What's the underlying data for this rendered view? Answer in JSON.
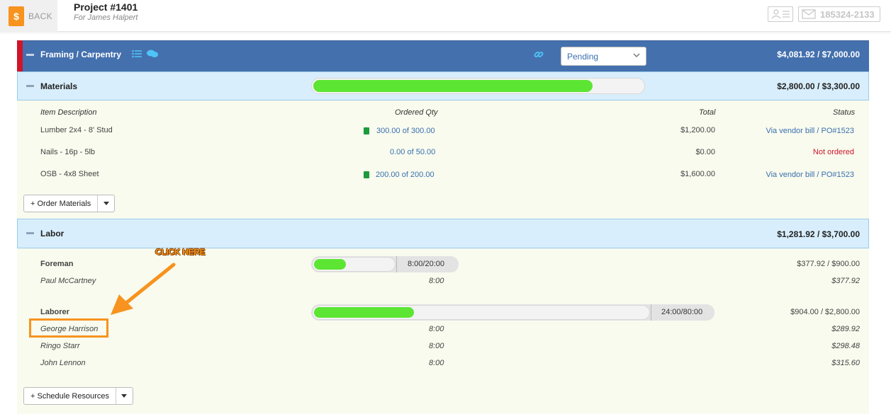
{
  "topbar": {
    "back_label": "BACK",
    "back_glyph": "$",
    "project_title": "Project #1401",
    "project_subtitle": "For James Halpert",
    "phone_label": "185324-2133"
  },
  "section": {
    "title": "Framing / Carpentry",
    "status": "Pending",
    "total": "$4,081.92 / $7,000.00",
    "accent_color": "#4470ae",
    "flag_color": "#d0142a"
  },
  "materials": {
    "title": "Materials",
    "total": "$2,800.00 / $3,300.00",
    "progress_fraction": 0.848,
    "headers": {
      "description": "Item Description",
      "qty": "Ordered Qty",
      "total": "Total",
      "status": "Status"
    },
    "rows": [
      {
        "description": "Lumber 2x4 - 8' Stud",
        "qty": "300.00 of 300.00",
        "has_clip": true,
        "total": "$1,200.00",
        "status": "Via vendor bill / PO#1523",
        "status_kind": "link"
      },
      {
        "description": "Nails - 16p - 5lb",
        "qty": "0.00 of 50.00",
        "has_clip": false,
        "total": "$0.00",
        "status": "Not ordered",
        "status_kind": "alert"
      },
      {
        "description": "OSB - 4x8 Sheet",
        "qty": "200.00 of 200.00",
        "has_clip": true,
        "total": "$1,600.00",
        "status": "Via vendor bill / PO#1523",
        "status_kind": "link"
      }
    ],
    "order_button": "+ Order Materials"
  },
  "labor": {
    "title": "Labor",
    "total": "$1,281.92 / $3,700.00",
    "roles": [
      {
        "role": "Foreman",
        "hours": "8:00/20:00",
        "progress_fraction": 0.4,
        "amount": "$377.92 / $900.00",
        "people": [
          {
            "name": "Paul McCartney",
            "hours": "8:00",
            "amount": "$377.92"
          }
        ]
      },
      {
        "role": "Laborer",
        "hours": "24:00/80:00",
        "progress_fraction": 0.3,
        "amount": "$904.00 / $2,800.00",
        "people": [
          {
            "name": "George Harrison",
            "hours": "8:00",
            "amount": "$289.92"
          },
          {
            "name": "Ringo Starr",
            "hours": "8:00",
            "amount": "$298.48"
          },
          {
            "name": "John Lennon",
            "hours": "8:00",
            "amount": "$315.60"
          }
        ]
      }
    ],
    "schedule_button": "+ Schedule Resources"
  },
  "annotation": {
    "label": "CLICK HERE",
    "color": "#f7931e"
  }
}
